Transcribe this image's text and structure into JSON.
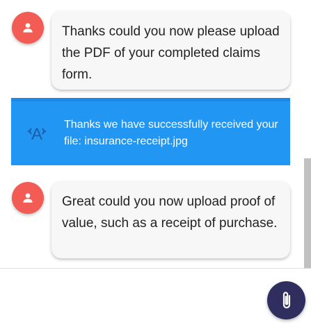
{
  "messages": [
    {
      "sender": "bot",
      "avatar_icon": "person-icon",
      "text": "Thanks could you now please upload the PDF of your completed claims form."
    },
    {
      "sender": "system",
      "icon": "broadcast-icon",
      "text": "Thanks we have successfully received your file: insurance-receipt.jpg"
    },
    {
      "sender": "bot",
      "avatar_icon": "person-icon",
      "text": "Great could you now upload proof of value, such as a receipt of purchase."
    }
  ],
  "composer": {
    "attach_icon": "paperclip-icon"
  },
  "colors": {
    "avatar": "#f25c54",
    "notice": "#2196f3",
    "attach_button": "#2f2e5e"
  }
}
